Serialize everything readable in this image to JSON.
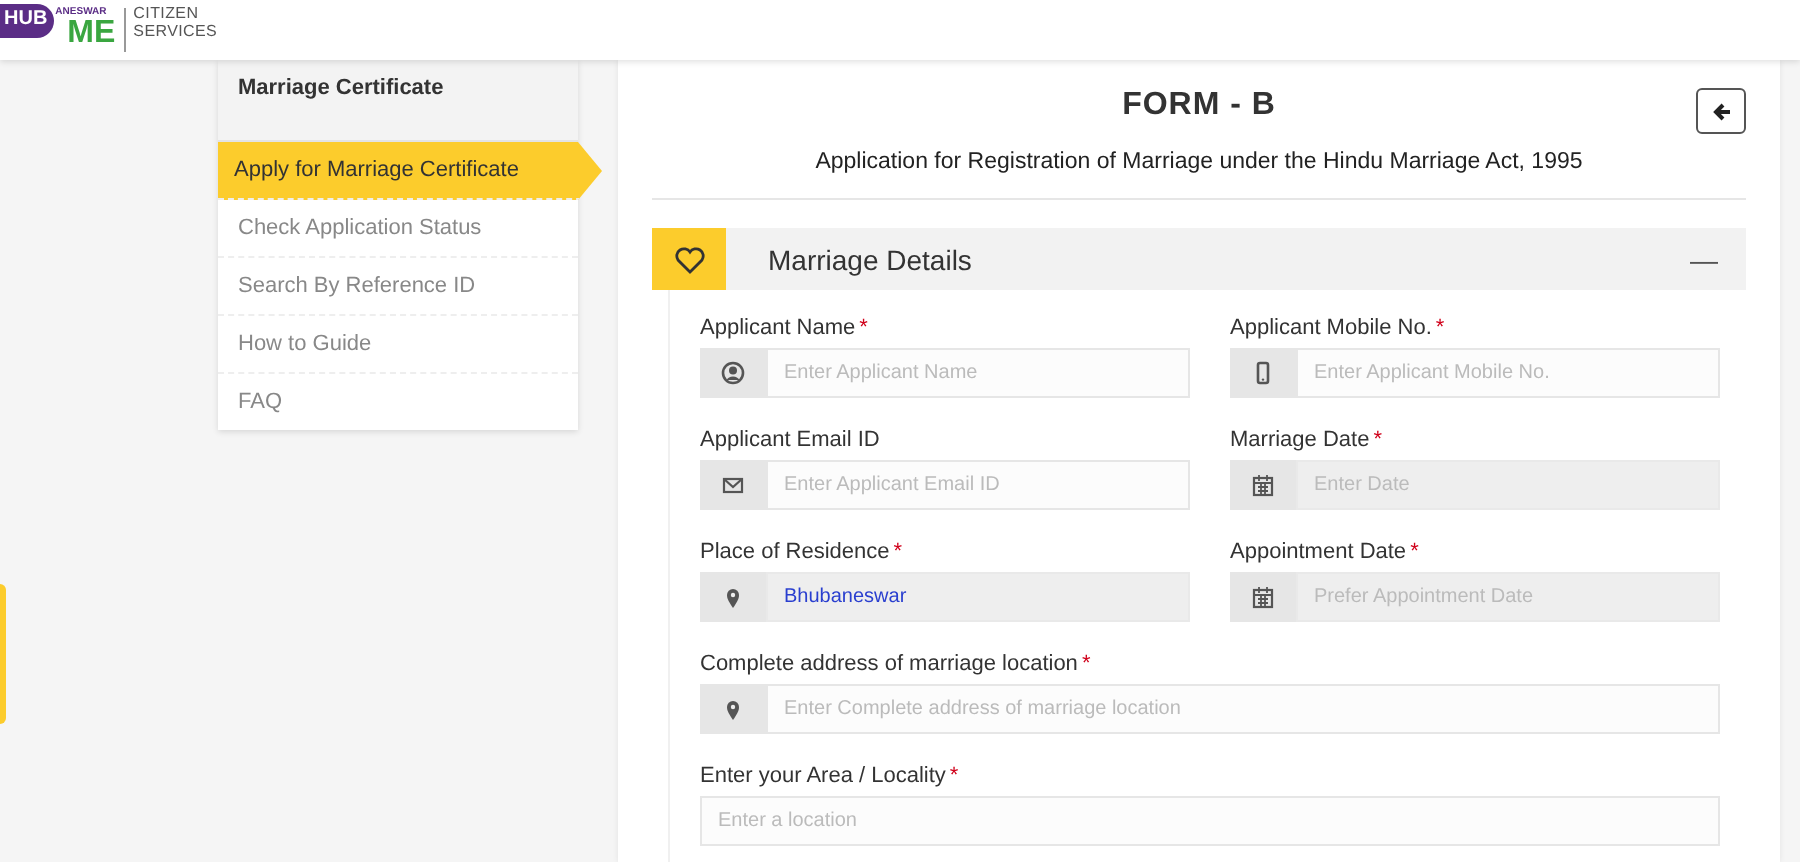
{
  "header": {
    "logo": {
      "hub": "HUB",
      "city": "ANESWAR",
      "me": "ME"
    },
    "brand": "CITIZEN SERVICES"
  },
  "sidebar": {
    "title": "Marriage Certificate",
    "items": [
      {
        "label": "Apply for Marriage Certificate",
        "selected": true
      },
      {
        "label": "Check Application Status",
        "selected": false
      },
      {
        "label": "Search By Reference ID",
        "selected": false
      },
      {
        "label": "How to Guide",
        "selected": false
      },
      {
        "label": "FAQ",
        "selected": false
      }
    ]
  },
  "form": {
    "title": "FORM - B",
    "subtitle": "Application for Registration of Marriage under the Hindu Marriage Act, 1995",
    "section": {
      "title": "Marriage Details",
      "toggle": "—"
    },
    "fields": [
      {
        "kind": "name",
        "label": "Applicant Name",
        "required_mark": "*",
        "placeholder": "Enter Applicant Name",
        "readonly": false
      },
      {
        "kind": "mobile",
        "label": "Applicant Mobile No.",
        "required_mark": "*",
        "placeholder": "Enter Applicant Mobile No.",
        "readonly": false
      },
      {
        "kind": "email",
        "label": "Applicant Email ID",
        "placeholder": "Enter Applicant Email ID",
        "readonly": false
      },
      {
        "kind": "date",
        "label": "Marriage Date",
        "required_mark": "*",
        "placeholder": "Enter Date",
        "readonly": true
      },
      {
        "kind": "place",
        "label": "Place of Residence",
        "required_mark": "*",
        "value": "Bhubaneswar",
        "readonly": true
      },
      {
        "kind": "date",
        "label": "Appointment Date",
        "required_mark": "*",
        "placeholder": "Prefer Appointment Date",
        "readonly": true
      },
      {
        "kind": "address",
        "label": "Complete address of marriage location",
        "required_mark": "*",
        "placeholder": "Enter Complete address of marriage location",
        "readonly": false
      },
      {
        "kind": "locality",
        "label": "Enter your Area / Locality",
        "required_mark": "*",
        "placeholder": "Enter a location",
        "readonly": false
      }
    ]
  }
}
